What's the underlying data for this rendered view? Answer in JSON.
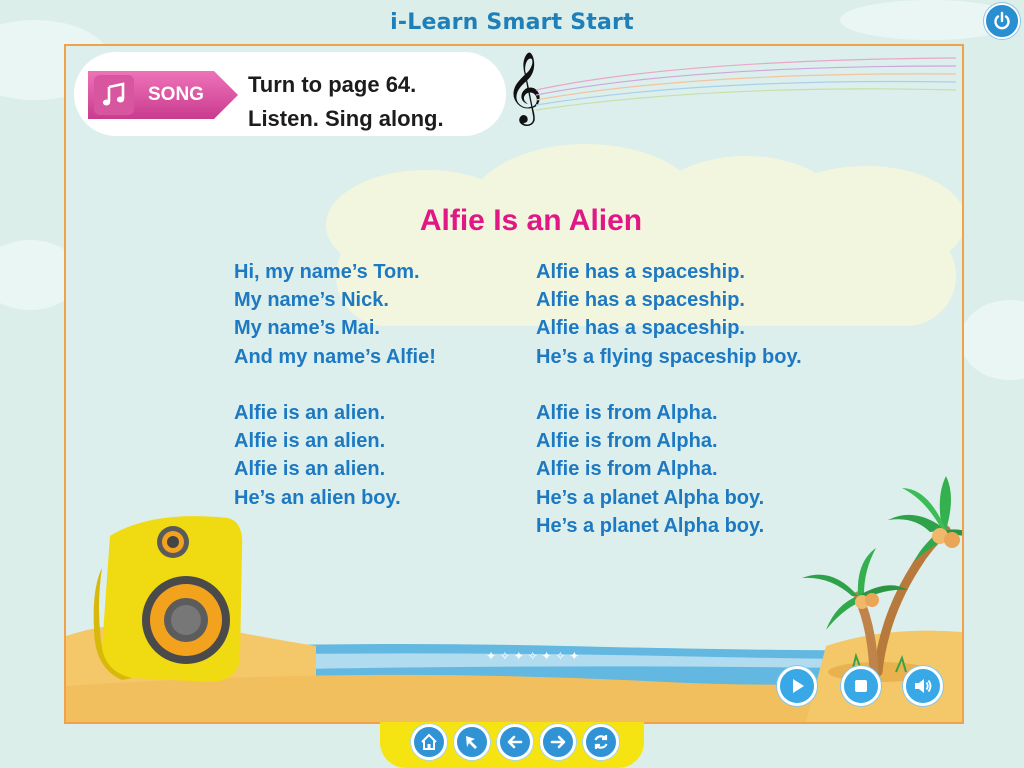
{
  "app": {
    "title": "i-Learn Smart Start"
  },
  "song_header": {
    "badge_label": "SONG",
    "instruction_line1": "Turn to page 64.",
    "instruction_line2": "Listen. Sing along."
  },
  "song": {
    "title": "Alfie Is an Alien",
    "column_left": [
      "Hi, my name’s Tom.",
      "My name’s Nick.",
      "My name’s Mai.",
      "And my name’s Alfie!",
      "",
      "Alfie is an alien.",
      "Alfie is an alien.",
      "Alfie is an alien.",
      "He’s an alien boy."
    ],
    "column_right": [
      "Alfie has a spaceship.",
      "Alfie has a spaceship.",
      "Alfie has a spaceship.",
      "He’s a flying spaceship boy.",
      "",
      "Alfie is from Alpha.",
      "Alfie is from Alpha.",
      "Alfie is from Alpha.",
      "He’s a planet Alpha boy.",
      "He’s a planet Alpha boy."
    ]
  },
  "media_controls": [
    "play-icon",
    "stop-icon",
    "volume-icon"
  ],
  "bottom_nav": [
    "home-icon",
    "pointer-icon",
    "back-arrow-icon",
    "forward-arrow-icon",
    "refresh-icon"
  ],
  "colors": {
    "background": "#dbeee9",
    "frame_border": "#f0a24b",
    "title_text": "#1f7fb8",
    "song_title": "#e01886",
    "lyrics": "#1d79c2",
    "song_badge": "#d8559f",
    "button_blue": "#39a8e6",
    "bottom_bar": "#f6e312"
  }
}
